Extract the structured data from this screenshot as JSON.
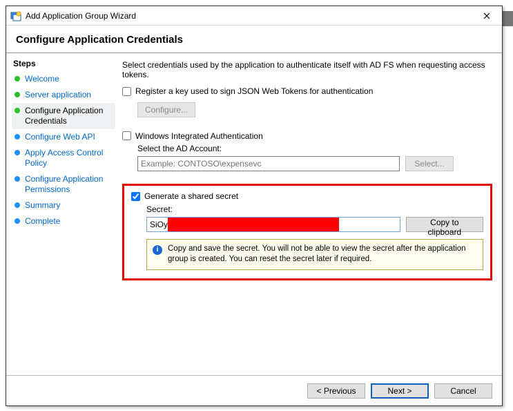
{
  "window": {
    "title": "Add Application Group Wizard"
  },
  "header": "Configure Application Credentials",
  "sidebar": {
    "heading": "Steps",
    "items": [
      {
        "label": "Welcome"
      },
      {
        "label": "Server application"
      },
      {
        "label": "Configure Application Credentials"
      },
      {
        "label": "Configure Web API"
      },
      {
        "label": "Apply Access Control Policy"
      },
      {
        "label": "Configure Application Permissions"
      },
      {
        "label": "Summary"
      },
      {
        "label": "Complete"
      }
    ]
  },
  "content": {
    "intro": "Select credentials used by the application to authenticate itself with AD FS when requesting access tokens.",
    "registerKey": {
      "label": "Register a key used to sign JSON Web Tokens for authentication",
      "configureBtn": "Configure..."
    },
    "wia": {
      "label": "Windows Integrated Authentication",
      "subLabel": "Select the AD Account:",
      "placeholder": "Example: CONTOSO\\expensevc",
      "selectBtn": "Select..."
    },
    "secret": {
      "label": "Generate a shared secret",
      "fieldLabel": "Secret:",
      "valueVisible": "SiOy",
      "copyBtn": "Copy to clipboard",
      "info": "Copy and save the secret.  You will not be able to view the secret after the application group is created.  You can reset the secret later if required."
    }
  },
  "footer": {
    "previous": "< Previous",
    "next": "Next >",
    "cancel": "Cancel"
  }
}
